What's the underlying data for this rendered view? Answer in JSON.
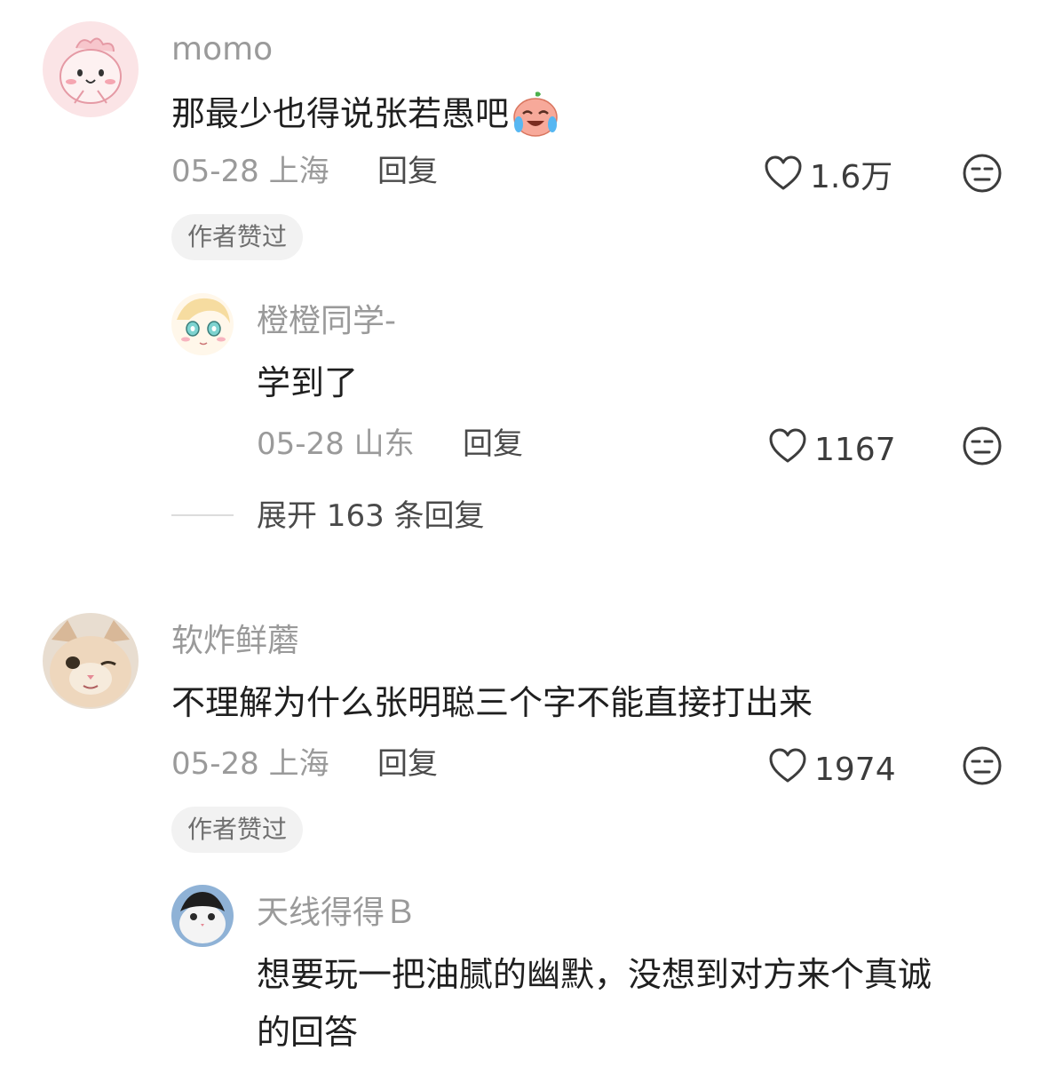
{
  "comments": [
    {
      "username": "momo",
      "text": "那最少也得说张若愚吧",
      "emoji_icon": "crying-laughing-emoji-icon",
      "date": "05-28",
      "location": "上海",
      "reply_label": "回复",
      "likes": "1.6万",
      "badge": "作者赞过",
      "replies": [
        {
          "username": "橙橙同学-",
          "text": "学到了",
          "date": "05-28",
          "location": "山东",
          "reply_label": "回复",
          "likes": "1167"
        }
      ],
      "expand_label": "展开 163 条回复"
    },
    {
      "username": "软炸鲜蘑",
      "text": "不理解为什么张明聪三个字不能直接打出来",
      "date": "05-28",
      "location": "上海",
      "reply_label": "回复",
      "likes": "1974",
      "badge": "作者赞过",
      "replies": [
        {
          "username": "天线得得Ｂ",
          "text_line1": "想要玩一把油腻的幽默，没想到对方来个真诚",
          "text_line2": "的回答"
        }
      ]
    }
  ],
  "colors": {
    "username": "#9a9a9a",
    "text": "#1f1f1f",
    "badge_bg": "#f2f2f2"
  }
}
